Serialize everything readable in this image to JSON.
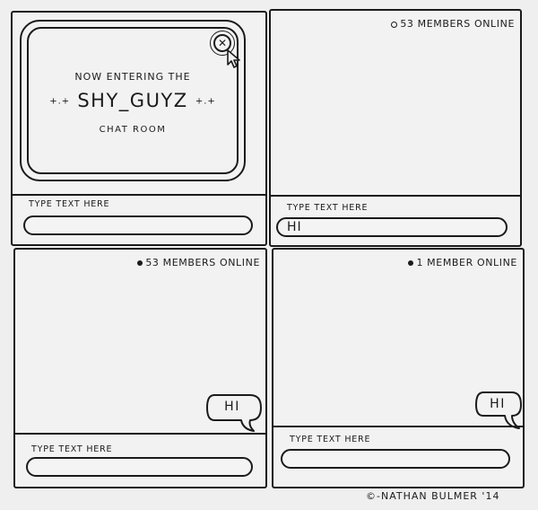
{
  "panel1": {
    "welcome_line1": "NOW ENTERING THE",
    "welcome_sparkle_left": "+.+",
    "welcome_room_name": "SHY_GUYZ",
    "welcome_sparkle_right": "+.+",
    "welcome_line3": "CHAT ROOM",
    "close_glyph": "✕",
    "input_label": "TYPE TEXT HERE",
    "input_value": ""
  },
  "panel2": {
    "members_online": "53 MEMBERS ONLINE",
    "input_label": "TYPE TEXT HERE",
    "input_value": "HI"
  },
  "panel3": {
    "members_online": "53 MEMBERS ONLINE",
    "message": "HI",
    "input_label": "TYPE TEXT HERE",
    "input_value": ""
  },
  "panel4": {
    "members_online": "1 MEMBER ONLINE",
    "message": "HI",
    "input_label": "TYPE TEXT HERE",
    "input_value": ""
  },
  "credit": "©-NATHAN BULMER '14",
  "icons": [
    "close-icon",
    "cursor-arrow-icon",
    "online-dot-icon",
    "speech-bubble-icon"
  ],
  "colors": {
    "ink": "#1b1b1b",
    "paper": "#efefef"
  }
}
